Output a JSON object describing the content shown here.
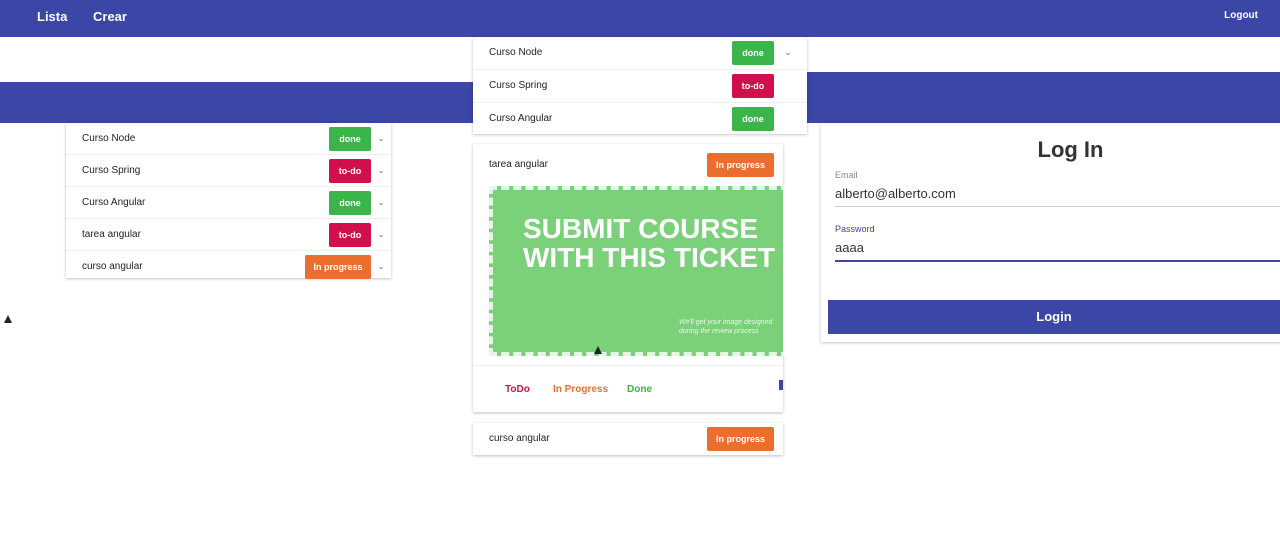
{
  "nav": {
    "links": [
      "Lista",
      "Crear"
    ],
    "logout": "Logout"
  },
  "left_list": {
    "items": [
      {
        "label": "Curso Node",
        "status": "done"
      },
      {
        "label": "Curso Spring",
        "status": "to-do"
      },
      {
        "label": "Curso Angular",
        "status": "done"
      },
      {
        "label": "tarea angular",
        "status": "to-do"
      },
      {
        "label": "curso angular",
        "status": "In progress"
      }
    ]
  },
  "middle_list": {
    "items": [
      {
        "label": "Curso Node",
        "status": "done"
      },
      {
        "label": "Curso Spring",
        "status": "to-do"
      },
      {
        "label": "Curso Angular",
        "status": "done"
      }
    ],
    "detail": {
      "label": "tarea angular",
      "status": "In progress",
      "ticket_title": "SUBMIT COURSE WITH THIS TICKET",
      "ticket_note": "We'll get your image designed during the review process",
      "actions": [
        "ToDo",
        "In Progress",
        "Done"
      ]
    },
    "last_item": {
      "label": "curso angular",
      "status": "In progress"
    }
  },
  "login": {
    "title": "Log In",
    "email_label": "Email",
    "email_value": "alberto@alberto.com",
    "password_label": "Password",
    "password_value": "aaaa",
    "button": "Login"
  },
  "colors": {
    "primary": "#3b46a6",
    "done": "#3bb54a",
    "todo": "#d0104c",
    "progress": "#ec6e2f"
  }
}
